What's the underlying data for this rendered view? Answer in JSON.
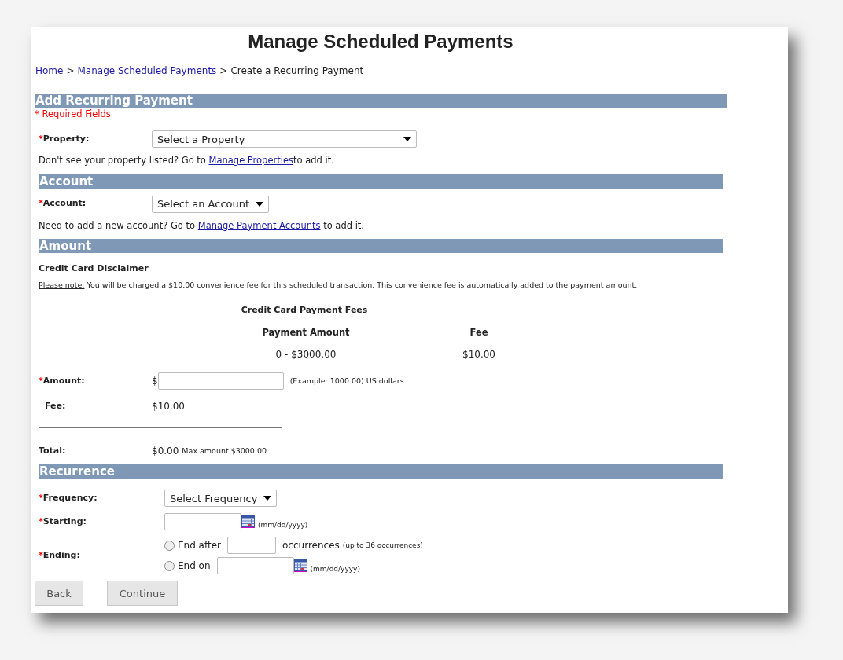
{
  "title": "Manage Scheduled Payments",
  "breadcrumb": {
    "separator": ">",
    "items": [
      {
        "label": "Home",
        "kind": "link"
      },
      {
        "label": "Manage Scheduled Payments",
        "kind": "link"
      },
      {
        "label": "Create a Recurring Payment",
        "kind": "current"
      }
    ]
  },
  "property_section": {
    "heading": "Add Recurring Payment",
    "required_note": "* Required Fields",
    "field": {
      "mark": "*",
      "label": "Property:",
      "value": "Select a Property"
    },
    "help": {
      "before": "Don't see your property listed? Go to ",
      "link": "Manage Properties",
      "after": "to add it."
    }
  },
  "account_section": {
    "heading": "Account",
    "field": {
      "mark": "*",
      "label": "Account:",
      "value": "Select an Account"
    },
    "help": {
      "before": "Need to add a new account? Go to ",
      "link": "Manage Payment Accounts",
      "after": " to add it."
    }
  },
  "amount_section": {
    "heading": "Amount",
    "disclaimer_title": "Credit Card Disclaimer",
    "note_label": "Please note:",
    "note_text": " You will be charged a $10.00 convenience fee for this scheduled transaction. This convenience fee is automatically added to the payment amount.",
    "fee_table": {
      "title": "Credit Card Payment Fees",
      "columns": [
        "Payment Amount",
        "Fee"
      ],
      "rows": [
        [
          "0 - $3000.00",
          "$10.00"
        ]
      ]
    },
    "amount": {
      "mark": "*",
      "label": "Amount:",
      "prefix": "$",
      "hint": "(Example: 1000.00) US dollars"
    },
    "fee": {
      "label": "Fee:",
      "value": "$10.00"
    },
    "total": {
      "label": "Total:",
      "value": "$0.00",
      "note": "Max amount $3000.00"
    }
  },
  "recurrence_section": {
    "heading": "Recurrence",
    "frequency": {
      "mark": "*",
      "label": "Frequency:",
      "value": "Select Frequency"
    },
    "starting": {
      "mark": "*",
      "label": "Starting:",
      "hint": "(mm/dd/yyyy)"
    },
    "ending": {
      "mark": "*",
      "label": "Ending:",
      "options": [
        {
          "kind": "count",
          "label": "End after",
          "selected": false,
          "unit": "occurrences",
          "hint": "(up to 36 occurrences)"
        },
        {
          "kind": "date",
          "label": "End on",
          "selected": false,
          "hint": "(mm/dd/yyyy)"
        }
      ]
    }
  },
  "buttons": [
    "Back",
    "Continue"
  ]
}
